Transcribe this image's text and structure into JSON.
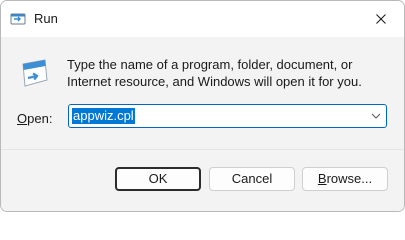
{
  "window": {
    "title": "Run"
  },
  "icons": {
    "title": "run-dialog-icon",
    "main": "run-program-icon",
    "close": "close-icon",
    "dropdown": "chevron-down-icon"
  },
  "description": "Type the name of a program, folder, document, or Internet resource, and Windows will open it for you.",
  "open": {
    "label_accel": "O",
    "label_rest": "pen:",
    "value": "appwiz.cpl"
  },
  "buttons": {
    "ok": "OK",
    "cancel": "Cancel",
    "browse_accel": "B",
    "browse_rest": "rowse..."
  },
  "colors": {
    "accent": "#0078d4",
    "focus_border": "#0067c0"
  }
}
